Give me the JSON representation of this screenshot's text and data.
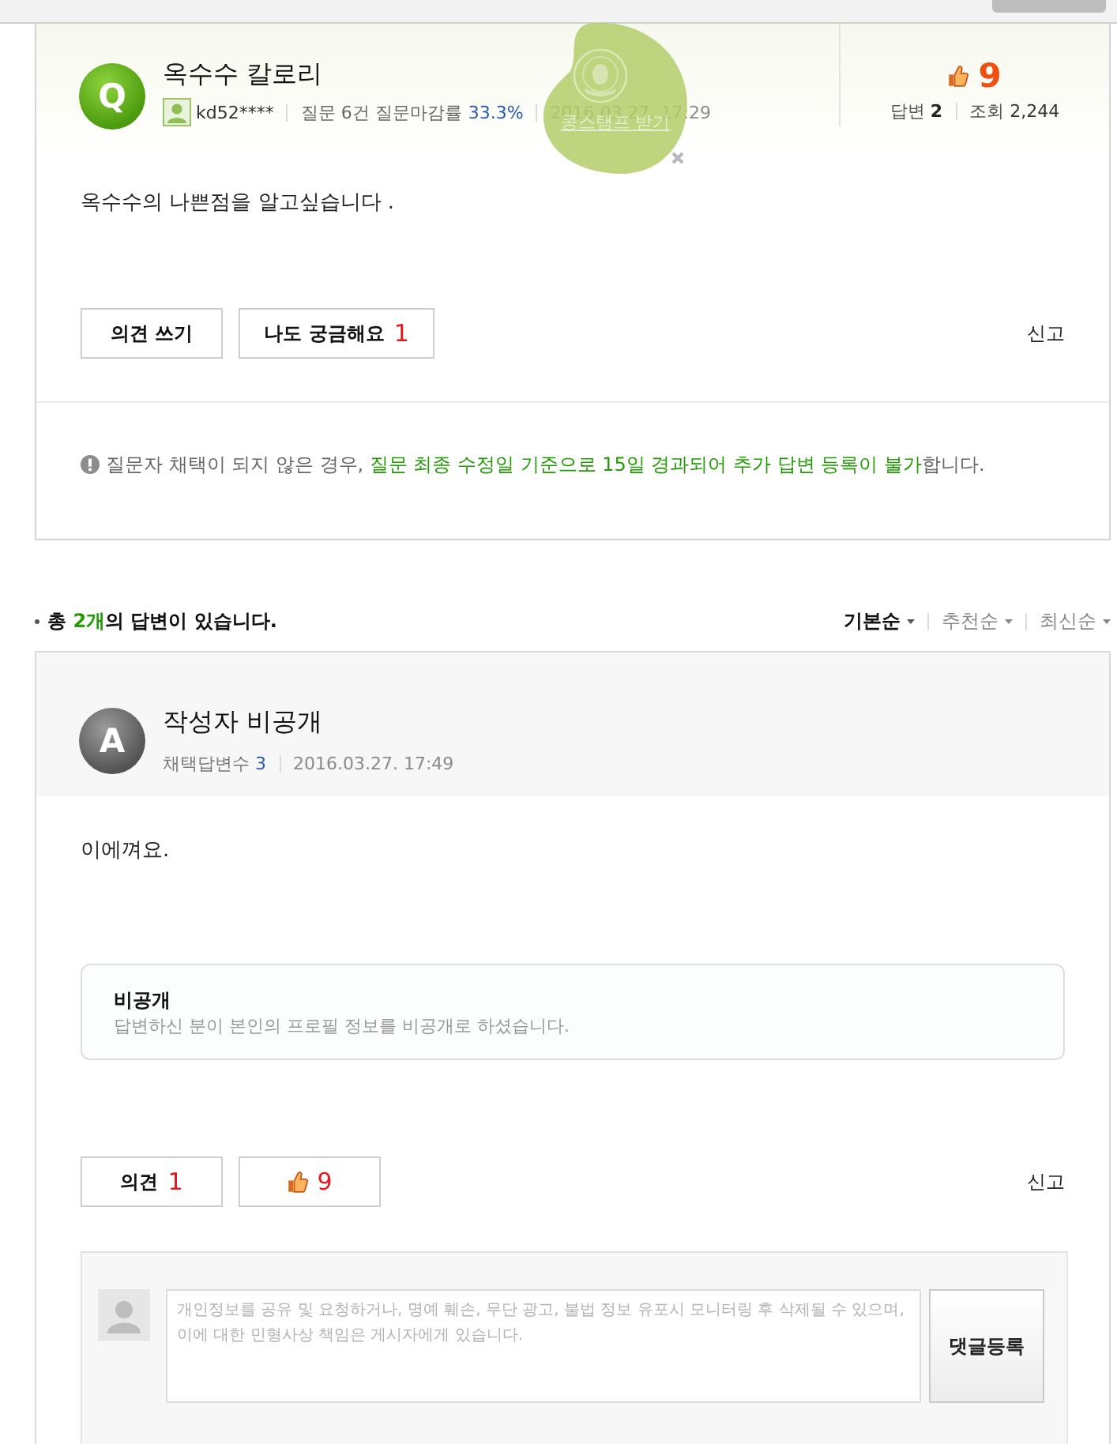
{
  "question": {
    "badge": "Q",
    "title": "옥수수 칼로리",
    "author": "kd52****",
    "stats": "질문 6건 질문마감률",
    "close_rate": "33.3%",
    "date": "2016.03.27. 17:29",
    "likes": "9",
    "counts": [
      {
        "label": "답변",
        "value": "2",
        "emphasis": true
      },
      {
        "label": "조회",
        "value": "2,244",
        "emphasis": false
      }
    ],
    "body": "옥수수의 나쁜점을 알고싶습니다 .",
    "actions": [
      {
        "kind": "opinion",
        "label": "의견 쓰기"
      },
      {
        "kind": "curious",
        "label": "나도 궁금해요",
        "count": "1"
      }
    ],
    "report": "신고",
    "notice": [
      {
        "text": "질문자 채택이 되지 않은 경우, ",
        "highlight": false
      },
      {
        "text": "질문 최종 수정일 기준으로 15일 경과되어 추가 답변 등록이 불가",
        "highlight": true
      },
      {
        "text": "합니다.",
        "highlight": false
      }
    ]
  },
  "stamp_promo": {
    "label": "콩스탬프 받기"
  },
  "answers": {
    "summary": [
      {
        "text": "총 ",
        "highlight": false
      },
      {
        "text": "2개",
        "highlight": true
      },
      {
        "text": "의 답변이 있습니다.",
        "highlight": false
      }
    ],
    "sort_options": [
      {
        "label": "기본순",
        "selected": true
      },
      {
        "label": "추천순",
        "selected": false
      },
      {
        "label": "최신순",
        "selected": false
      }
    ],
    "items": [
      {
        "badge": "A",
        "author": "작성자 비공개",
        "adopted_label": "채택답변수",
        "adopted_count": "3",
        "date": "2016.03.27. 17:49",
        "body": "이에껴요.",
        "private_notice": {
          "title": "비공개",
          "text": "답변하신 분이 본인의 프로필 정보를 비공개로 하셨습니다."
        },
        "actions": [
          {
            "kind": "opinion",
            "label": "의견",
            "count": "1"
          },
          {
            "kind": "like",
            "count": "9"
          }
        ],
        "report": "신고",
        "comment": {
          "placeholder": "개인정보를 공유 및 요청하거나, 명예 훼손, 무단 광고, 불법 정보 유포시 모니터링 후 삭제될 수 있으며,\n이에 대한 민형사상 책임은 게시자에게 있습니다.",
          "submit": "댓글등록"
        }
      }
    ]
  }
}
